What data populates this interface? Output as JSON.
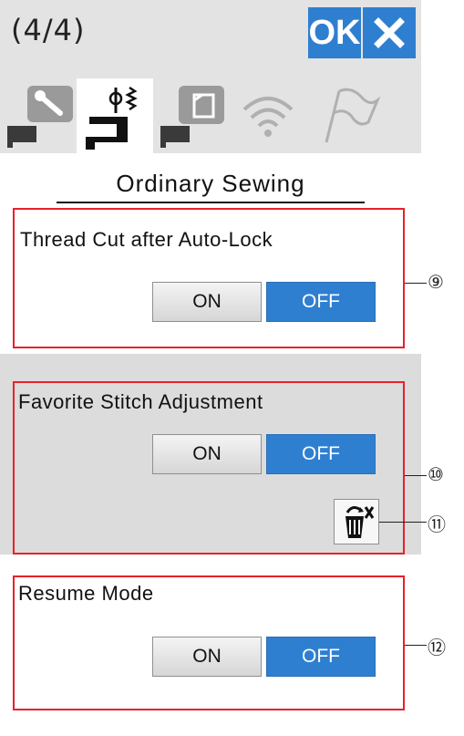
{
  "header": {
    "page_indicator": "(4/4)",
    "ok_label": "OK",
    "close_icon": "close-x-icon"
  },
  "tabs": [
    {
      "icon": "wrench-icon",
      "active": false
    },
    {
      "icon": "needle-thread-icon",
      "active": true
    },
    {
      "icon": "embroidery-hoop-icon",
      "active": false
    },
    {
      "icon": "wifi-icon",
      "active": false
    },
    {
      "icon": "flag-icon",
      "active": false
    }
  ],
  "section_title": "Ordinary Sewing",
  "settings": {
    "thread_cut": {
      "label": "Thread Cut after Auto-Lock",
      "on_label": "ON",
      "off_label": "OFF",
      "selected": "OFF",
      "callout": "⑨"
    },
    "favorite_stitch": {
      "label": "Favorite Stitch Adjustment",
      "on_label": "ON",
      "off_label": "OFF",
      "selected": "OFF",
      "callout": "⑩",
      "delete_callout": "⑪",
      "delete_icon": "trash-delete-icon"
    },
    "resume_mode": {
      "label": "Resume Mode",
      "on_label": "ON",
      "off_label": "OFF",
      "selected": "OFF",
      "callout": "⑫"
    }
  },
  "colors": {
    "accent_blue": "#2f7fd0",
    "frame_red": "#e8212b",
    "panel_gray": "#dcdcdc"
  }
}
